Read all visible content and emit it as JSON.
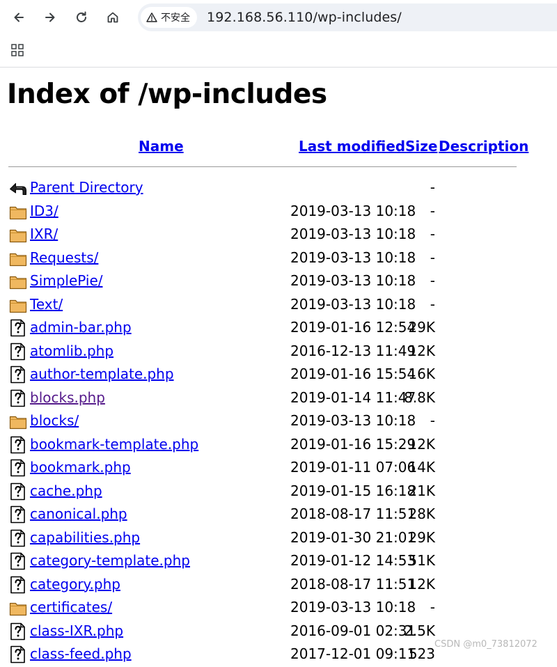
{
  "browser": {
    "security_label": "不安全",
    "url": "192.168.56.110/wp-includes/",
    "icons": {
      "back": "back-arrow-icon",
      "forward": "forward-arrow-icon",
      "reload": "reload-icon",
      "home": "home-icon",
      "security": "warning-triangle-icon",
      "apps": "apps-grid-icon"
    }
  },
  "page": {
    "title": "Index of /wp-includes",
    "columns": {
      "name": "Name",
      "last_modified": "Last modified",
      "size": "Size",
      "description": "Description"
    },
    "rows": [
      {
        "name": "Parent Directory",
        "modified": "",
        "size": "-",
        "type": "parent"
      },
      {
        "name": "ID3/",
        "modified": "2019-03-13 10:18",
        "size": "-",
        "type": "folder"
      },
      {
        "name": "IXR/",
        "modified": "2019-03-13 10:18",
        "size": "-",
        "type": "folder"
      },
      {
        "name": "Requests/",
        "modified": "2019-03-13 10:18",
        "size": "-",
        "type": "folder"
      },
      {
        "name": "SimplePie/",
        "modified": "2019-03-13 10:18",
        "size": "-",
        "type": "folder"
      },
      {
        "name": "Text/",
        "modified": "2019-03-13 10:18",
        "size": "-",
        "type": "folder"
      },
      {
        "name": "admin-bar.php",
        "modified": "2019-01-16 12:54",
        "size": "29K",
        "type": "file"
      },
      {
        "name": "atomlib.php",
        "modified": "2016-12-13 11:49",
        "size": "12K",
        "type": "file"
      },
      {
        "name": "author-template.php",
        "modified": "2019-01-16 15:54",
        "size": "16K",
        "type": "file"
      },
      {
        "name": "blocks.php",
        "modified": "2019-01-14 11:47",
        "size": "8.8K",
        "type": "file",
        "visited": true
      },
      {
        "name": "blocks/",
        "modified": "2019-03-13 10:18",
        "size": "-",
        "type": "folder"
      },
      {
        "name": "bookmark-template.php",
        "modified": "2019-01-16 15:29",
        "size": "12K",
        "type": "file"
      },
      {
        "name": "bookmark.php",
        "modified": "2019-01-11 07:06",
        "size": "14K",
        "type": "file"
      },
      {
        "name": "cache.php",
        "modified": "2019-01-15 16:18",
        "size": "21K",
        "type": "file"
      },
      {
        "name": "canonical.php",
        "modified": "2018-08-17 11:51",
        "size": "28K",
        "type": "file"
      },
      {
        "name": "capabilities.php",
        "modified": "2019-01-30 21:01",
        "size": "29K",
        "type": "file"
      },
      {
        "name": "category-template.php",
        "modified": "2019-01-12 14:53",
        "size": "51K",
        "type": "file"
      },
      {
        "name": "category.php",
        "modified": "2018-08-17 11:51",
        "size": "12K",
        "type": "file"
      },
      {
        "name": "certificates/",
        "modified": "2019-03-13 10:18",
        "size": "-",
        "type": "folder"
      },
      {
        "name": "class-IXR.php",
        "modified": "2016-09-01 02:31",
        "size": "2.5K",
        "type": "file"
      },
      {
        "name": "class-feed.php",
        "modified": "2017-12-01 09:11",
        "size": "523",
        "type": "file"
      }
    ]
  },
  "watermark": "CSDN @m0_73812072",
  "colors": {
    "link": "#0000ee",
    "visited_link": "#551a8b",
    "folder_fill": "#f0b860",
    "omnibox_bg": "#eef1f6"
  }
}
